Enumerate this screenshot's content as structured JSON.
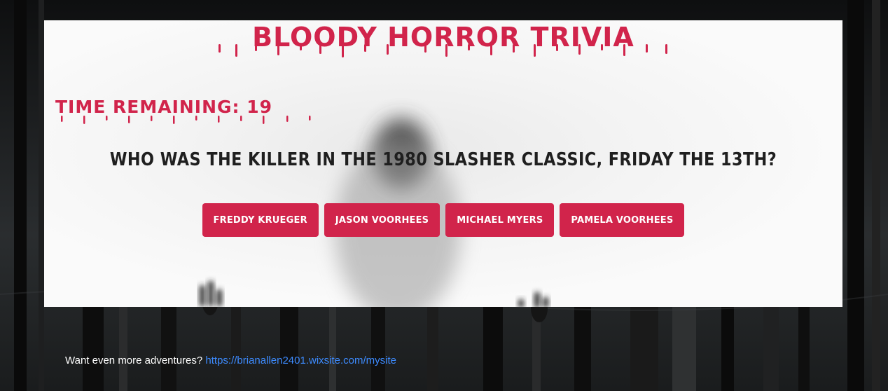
{
  "header": {
    "title": "BLOODY HORROR TRIVIA"
  },
  "timer": {
    "label": "TIME REMAINING: 19"
  },
  "question": {
    "text": "WHO WAS THE KILLER IN THE 1980 SLASHER CLASSIC, FRIDAY THE 13TH?"
  },
  "answers": [
    {
      "label": "FREDDY KRUEGER"
    },
    {
      "label": "JASON VOORHEES"
    },
    {
      "label": "MICHAEL MYERS"
    },
    {
      "label": "PAMELA VOORHEES"
    }
  ],
  "footer": {
    "prompt": "Want even more adventures?",
    "link_text": "https://brianallen2401.wixsite.com/mysite",
    "link_href": "https://brianallen2401.wixsite.com/mysite"
  },
  "colors": {
    "accent": "#d1244b",
    "question_text": "#1f1f1f",
    "link": "#3d8bff",
    "panel": "#f7f7f7"
  }
}
